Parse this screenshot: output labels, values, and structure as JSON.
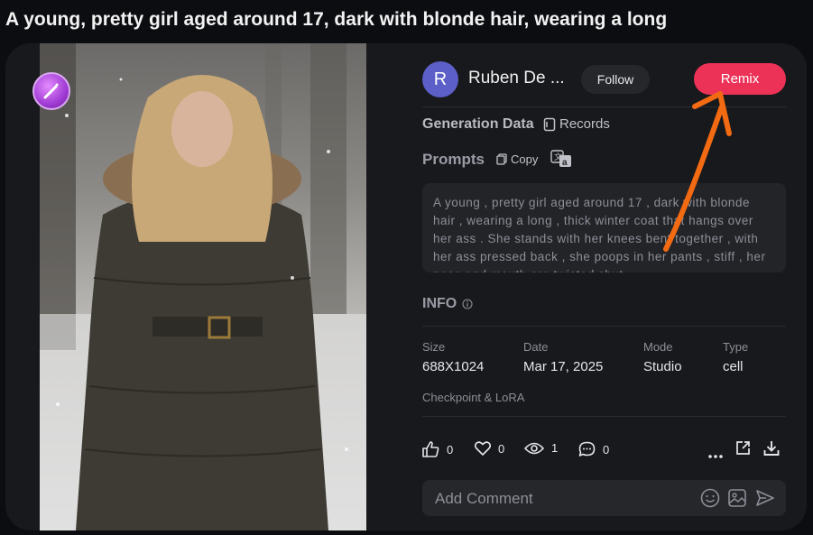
{
  "page": {
    "title": "A young, pretty girl aged around 17, dark with blonde hair, wearing a long"
  },
  "author": {
    "avatar_letter": "R",
    "name": "Ruben De ...",
    "follow_label": "Follow",
    "remix_label": "Remix"
  },
  "generation": {
    "label": "Generation Data",
    "records_label": "Records"
  },
  "prompts": {
    "label": "Prompts",
    "copy_label": "Copy",
    "text": "A young , pretty girl aged around 17 , dark with blonde hair , wearing a long , thick winter coat that hangs over her ass . She stands with her knees bent together , with her ass pressed back , she poops in her pants , stiff , her nose and mouth are twisted shut"
  },
  "info": {
    "label": "INFO",
    "fields": [
      {
        "label": "Size",
        "value": "688X1024"
      },
      {
        "label": "Date",
        "value": "Mar 17, 2025"
      },
      {
        "label": "Mode",
        "value": "Studio"
      },
      {
        "label": "Type",
        "value": "cell"
      }
    ],
    "checkpoint_label": "Checkpoint & LoRA"
  },
  "stats": {
    "likes": "0",
    "favorites": "0",
    "views": "1",
    "comments": "0"
  },
  "comment": {
    "placeholder": "Add Comment"
  },
  "colors": {
    "accent": "#ec3257",
    "avatar": "#5b5fc7",
    "annotation_arrow": "#f26a12"
  }
}
